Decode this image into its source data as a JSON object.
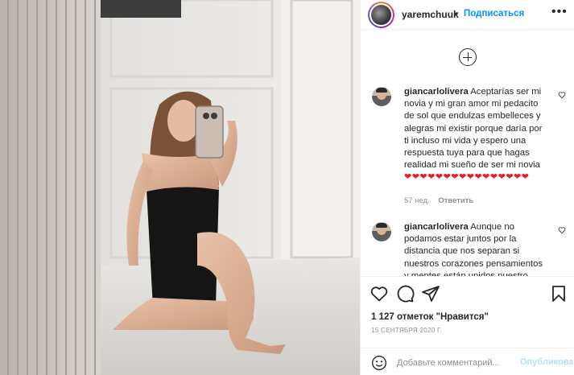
{
  "post": {
    "photo_alt": "",
    "colors": {
      "accent": "#0095f6",
      "heart": "#ed1c24",
      "muted": "#8e8e8e"
    }
  },
  "header": {
    "username": "yaremchuuk",
    "separator": "•",
    "follow_label": "Подписаться",
    "more_label": "•••"
  },
  "comments": [
    {
      "username": "giancarlolivera",
      "text": "Aceptarías ser mi novia y mi gran amor mi pedacito de sol que endulzas embelleces y alegras mi existir porque daría por ti incluso mi vida y espero una respuesta tuya para que hagas realidad mi sueño de ser mi novia",
      "hearts": "❤❤❤❤❤❤❤❤❤❤❤❤❤❤❤❤",
      "time": "57 нед.",
      "reply_label": "Ответить"
    },
    {
      "username": "giancarlolivera",
      "text": "Aunque no podamos estar juntos por la distancia que nos separan si nuestros corazones pensamientos y mentes están unidos nuestro amor",
      "hearts": "",
      "time": "",
      "reply_label": ""
    }
  ],
  "actions": {
    "icons": [
      "heart-icon",
      "comment-icon",
      "share-icon",
      "bookmark-icon"
    ]
  },
  "likes_text": "1 127 отметок \"Нравится\"",
  "date_text": "15 СЕНТЯБРЯ 2020 Г.",
  "add_comment": {
    "placeholder": "Добавьте комментарий...",
    "publish_label": "Опубликовать"
  }
}
